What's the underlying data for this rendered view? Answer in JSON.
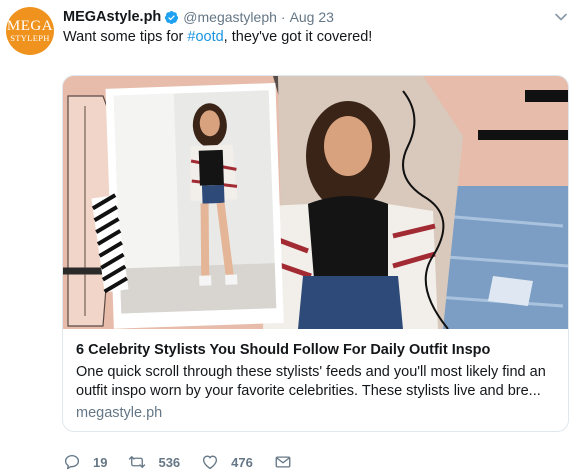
{
  "avatar": {
    "line1": "MEGA",
    "line2": "STYLEPH",
    "icon": "mega-logo",
    "color": "#f0931e"
  },
  "tweet": {
    "display_name": "MEGAstyle.ph",
    "handle": "@megastyleph",
    "separator": "·",
    "time": "Aug 23",
    "text_before": "Want some tips for ",
    "hashtag": "#ootd",
    "text_after": ", they've got it covered!"
  },
  "card": {
    "title": "6 Celebrity Stylists You Should Follow For Daily Outfit Inspo",
    "description": "One quick scroll through these stylists' feeds and you'll most likely find an outfit inspo worn by your favorite celebrities. These stylists live and bre...",
    "domain": "megastyle.ph"
  },
  "actions": {
    "reply_count": "19",
    "retweet_count": "536",
    "like_count": "476"
  },
  "colors": {
    "link": "#1b95e0",
    "muted": "#657786",
    "text": "#14171a",
    "verified": "#1da1f2"
  }
}
